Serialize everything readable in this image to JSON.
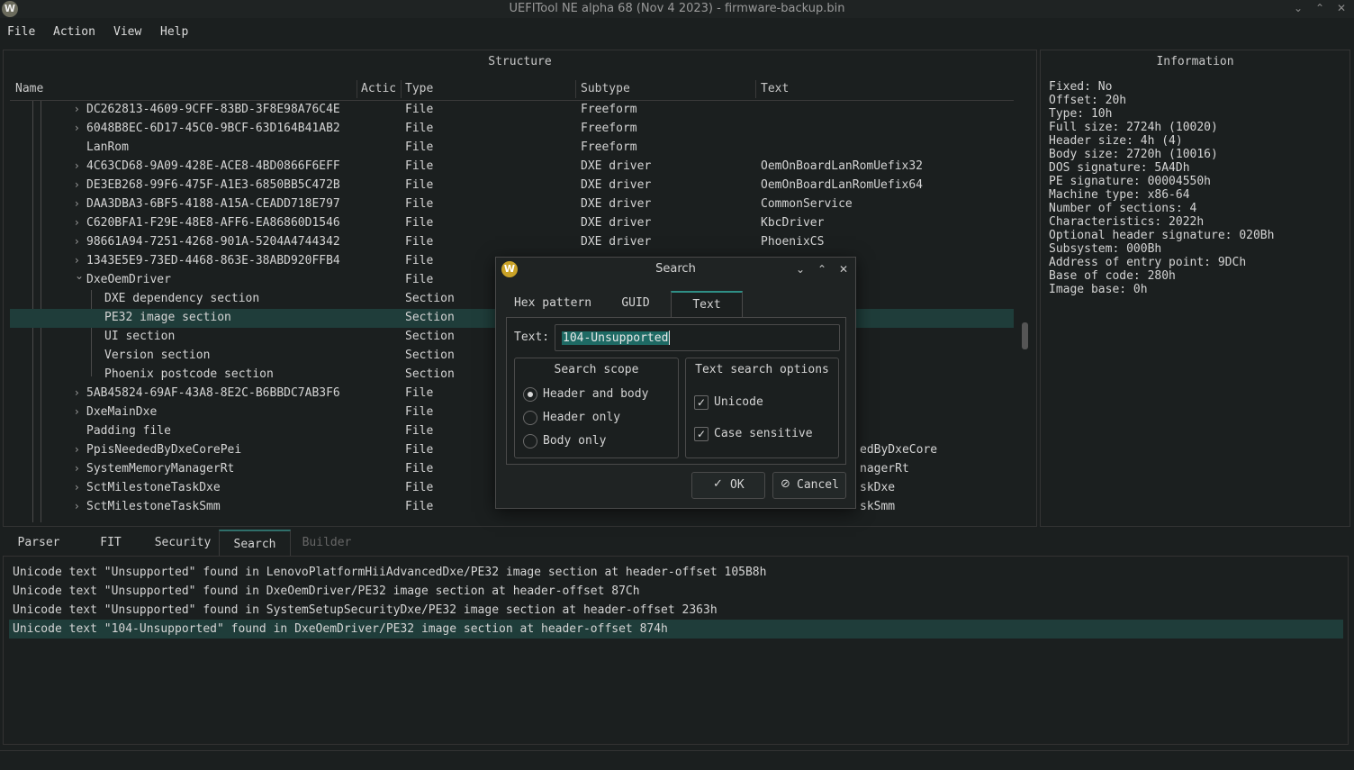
{
  "window": {
    "title": "UEFITool NE alpha 68 (Nov 4 2023) - firmware-backup.bin",
    "icon_letter": "W"
  },
  "menu": [
    "File",
    "Action",
    "View",
    "Help"
  ],
  "structure": {
    "title": "Structure",
    "columns": [
      "Name",
      "Actic",
      "Type",
      "Subtype",
      "Text"
    ],
    "rows": [
      {
        "name": "DC262813-4609-9CFF-83BD-3F8E98A76C4E",
        "type": "File",
        "subtype": "Freeform",
        "text": ""
      },
      {
        "name": "6048B8EC-6D17-45C0-9BCF-63D164B41AB2",
        "type": "File",
        "subtype": "Freeform",
        "text": ""
      },
      {
        "name": "LanRom",
        "type": "File",
        "subtype": "Freeform",
        "text": ""
      },
      {
        "name": "4C63CD68-9A09-428E-ACE8-4BD0866F6EFF",
        "type": "File",
        "subtype": "DXE driver",
        "text": "OemOnBoardLanRomUefix32"
      },
      {
        "name": "DE3EB268-99F6-475F-A1E3-6850BB5C472B",
        "type": "File",
        "subtype": "DXE driver",
        "text": "OemOnBoardLanRomUefix64"
      },
      {
        "name": "DAA3DBA3-6BF5-4188-A15A-CEADD718E797",
        "type": "File",
        "subtype": "DXE driver",
        "text": "CommonService"
      },
      {
        "name": "C620BFA1-F29E-48E8-AFF6-EA86860D1546",
        "type": "File",
        "subtype": "DXE driver",
        "text": "KbcDriver"
      },
      {
        "name": "98661A94-7251-4268-901A-5204A4744342",
        "type": "File",
        "subtype": "DXE driver",
        "text": "PhoenixCS"
      },
      {
        "name": "1343E5E9-73ED-4468-863E-38ABD920FFB4",
        "type": "File",
        "subtype": "",
        "text": ""
      },
      {
        "name": "DxeOemDriver",
        "type": "File",
        "subtype": "",
        "text": ""
      },
      {
        "name": "DXE dependency section",
        "type": "Section",
        "subtype": "",
        "text": ""
      },
      {
        "name": "PE32 image section",
        "type": "Section",
        "subtype": "",
        "text": ""
      },
      {
        "name": "UI section",
        "type": "Section",
        "subtype": "",
        "text": ""
      },
      {
        "name": "Version section",
        "type": "Section",
        "subtype": "",
        "text": ""
      },
      {
        "name": "Phoenix postcode section",
        "type": "Section",
        "subtype": "",
        "text": ""
      },
      {
        "name": "5AB45824-69AF-43A8-8E2C-B6BBDC7AB3F6",
        "type": "File",
        "subtype": "",
        "text": ""
      },
      {
        "name": "DxeMainDxe",
        "type": "File",
        "subtype": "",
        "text": ""
      },
      {
        "name": "Padding file",
        "type": "File",
        "subtype": "",
        "text": ""
      },
      {
        "name": "PpisNeededByDxeCorePei",
        "type": "File",
        "subtype": "",
        "text": "edByDxeCore"
      },
      {
        "name": "SystemMemoryManagerRt",
        "type": "File",
        "subtype": "",
        "text": "nagerRt"
      },
      {
        "name": "SctMilestoneTaskDxe",
        "type": "File",
        "subtype": "",
        "text": "skDxe"
      },
      {
        "name": "SctMilestoneTaskSmm",
        "type": "File",
        "subtype": "",
        "text": "skSmm"
      }
    ]
  },
  "information": {
    "title": "Information",
    "lines": [
      "Fixed: No",
      "Offset: 20h",
      "Type: 10h",
      "Full size: 2724h (10020)",
      "Header size: 4h (4)",
      "Body size: 2720h (10016)",
      "DOS signature: 5A4Dh",
      "PE signature: 00004550h",
      "Machine type: x86-64",
      "Number of sections: 4",
      "Characteristics: 2022h",
      "Optional header signature: 020Bh",
      "Subsystem: 000Bh",
      "Address of entry point: 9DCh",
      "Base of code: 280h",
      "Image base: 0h"
    ]
  },
  "bottom_tabs": [
    "Parser",
    "FIT",
    "Security",
    "Search",
    "Builder"
  ],
  "messages": [
    "Unicode text \"Unsupported\" found in LenovoPlatformHiiAdvancedDxe/PE32 image section at header-offset 105B8h",
    "Unicode text \"Unsupported\" found in DxeOemDriver/PE32 image section at header-offset 87Ch",
    "Unicode text \"Unsupported\" found in SystemSetupSecurityDxe/PE32 image section at header-offset 2363h",
    "Unicode text \"104-Unsupported\" found in DxeOemDriver/PE32 image section at header-offset 874h"
  ],
  "dialog": {
    "title": "Search",
    "tabs": [
      "Hex pattern",
      "GUID",
      "Text"
    ],
    "text_label": "Text:",
    "text_value": "104-Unsupported",
    "scope": {
      "title": "Search scope",
      "options": [
        "Header and body",
        "Header only",
        "Body only"
      ],
      "selected": "Header and body"
    },
    "options": {
      "title": "Text search options",
      "unicode": "Unicode",
      "case_sensitive": "Case sensitive"
    },
    "ok_label": "OK",
    "cancel_label": "Cancel"
  }
}
